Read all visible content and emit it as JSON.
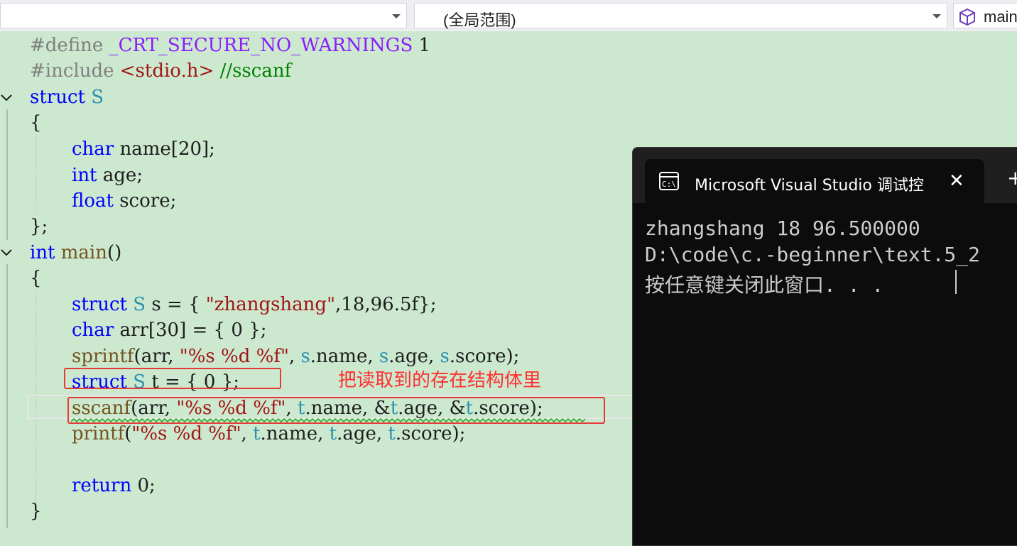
{
  "navbar": {
    "project_combo": "",
    "scope_combo": "(全局范围)",
    "member_combo": "main"
  },
  "code": {
    "line1": {
      "directive": "#define",
      "macro": "_CRT_SECURE_NO_WARNINGS",
      "value": "1"
    },
    "line2": {
      "directive": "#include",
      "header": "<stdio.h>",
      "comment": "//sscanf"
    },
    "line3": {
      "kw": "struct",
      "type": "S"
    },
    "line4": {
      "text": "{"
    },
    "line5": {
      "kw": "char",
      "rest": "name[20];"
    },
    "line6": {
      "kw": "int",
      "rest": "age;"
    },
    "line7": {
      "kw": "float",
      "rest": "score;"
    },
    "line8": {
      "text": "};"
    },
    "line9": {
      "kw": "int",
      "fn": "main",
      "rest": "()"
    },
    "line10": {
      "text": "{"
    },
    "line11": {
      "kw": "struct",
      "type": "S",
      "var": "s",
      "eq": "= {",
      "str": "\"zhangshang\"",
      "rest": ",18,96.5f};"
    },
    "line12": {
      "kw": "char",
      "var": "arr",
      "rest": "[30] = { 0 };"
    },
    "line13": {
      "fn": "sprintf",
      "open": "(arr, ",
      "fmt": "\"%s %d %f\"",
      "sep1": ", ",
      "v1": "s",
      "m1": ".name, ",
      "v2": "s",
      "m2": ".age, ",
      "v3": "s",
      "m3": ".score);"
    },
    "line14": {
      "kw": "struct",
      "type": "S",
      "var": "t",
      "rest": "= { 0 };"
    },
    "line15": {
      "fn": "sscanf",
      "open": "(arr, ",
      "fmt": "\"%s %d %f\"",
      "sep1": ", ",
      "v1": "t",
      "m1": ".name, &",
      "v2": "t",
      "m2": ".age, &",
      "v3": "t",
      "m3": ".score);"
    },
    "line16": {
      "fn": "printf",
      "open": "(",
      "fmt": "\"%s %d %f\"",
      "sep1": ", ",
      "v1": "t",
      "m1": ".name, ",
      "v2": "t",
      "m2": ".age, ",
      "v3": "t",
      "m3": ".score);"
    },
    "line18": {
      "kw": "return",
      "rest": "0;"
    },
    "line19": {
      "text": "}"
    }
  },
  "annotation": "把读取到的存在结构体里",
  "terminal": {
    "tab_title": "Microsoft Visual Studio 调试控",
    "close_glyph": "✕",
    "new_tab_glyph": "+",
    "output": [
      "zhangshang 18 96.500000",
      "D:\\code\\c.-beginner\\text.5_2",
      "按任意键关闭此窗口. . ."
    ]
  },
  "colors": {
    "editor_bg": "#cce8cf",
    "keyword": "#0000ff",
    "type": "#2b91af",
    "string": "#a31515",
    "macro": "#8a1bff",
    "comment": "#008000",
    "annotation": "#ff3030",
    "terminal_bg": "#0c0c0c"
  }
}
